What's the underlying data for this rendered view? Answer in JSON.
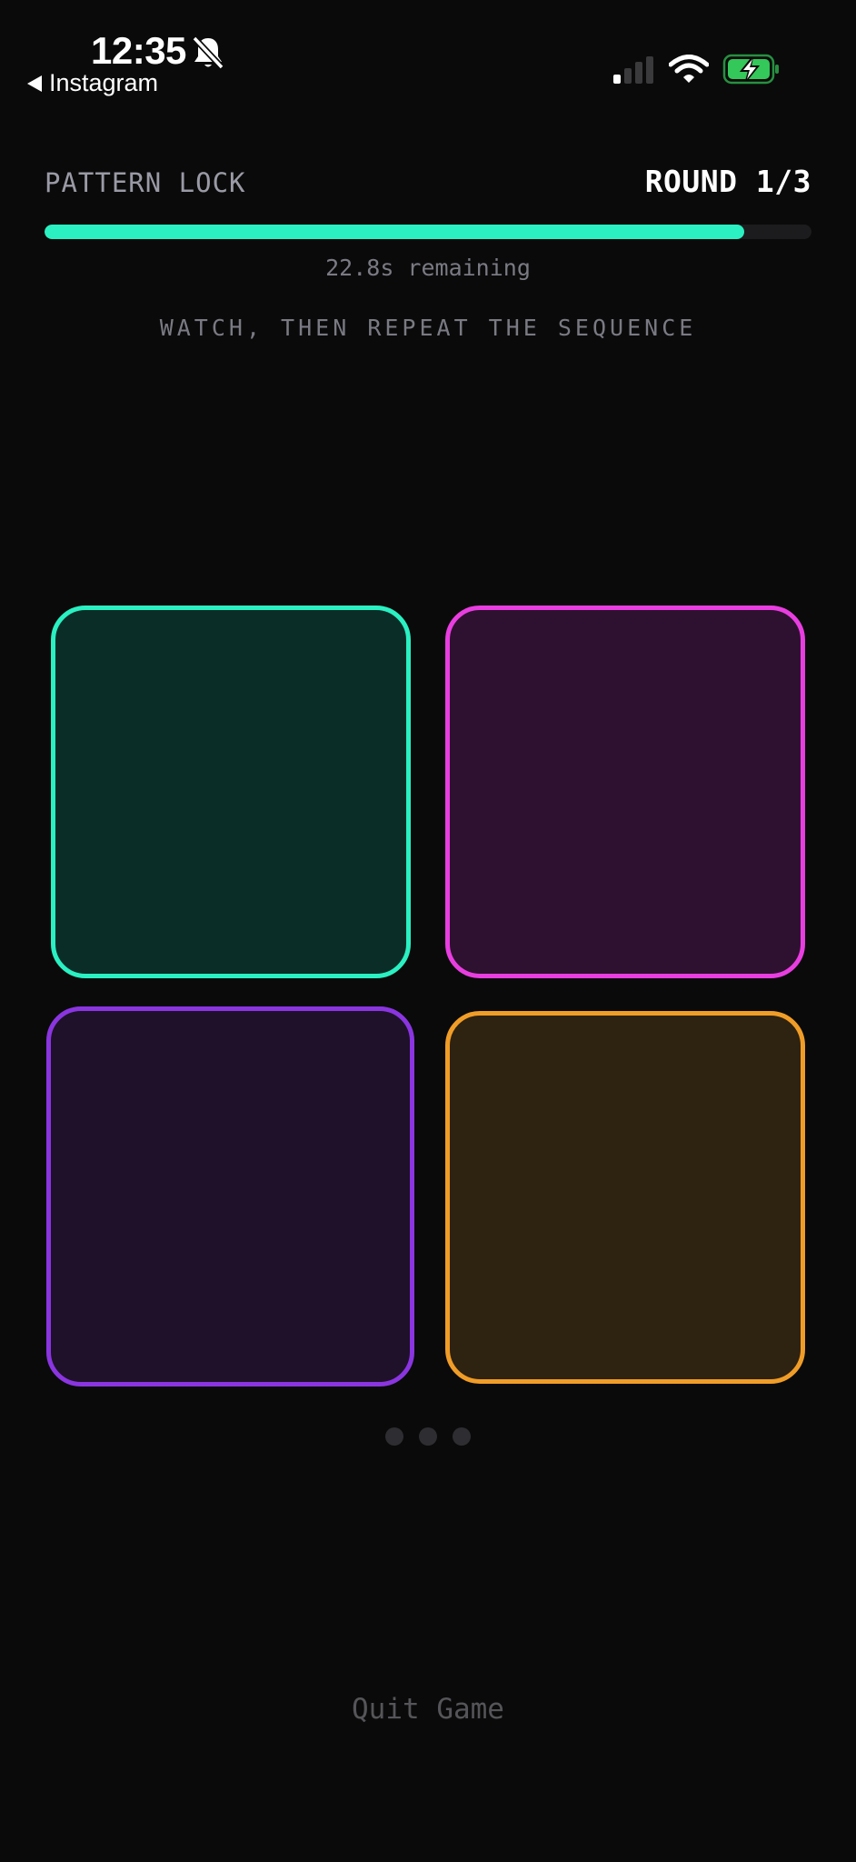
{
  "status_bar": {
    "time": "12:35",
    "back_label": "Instagram",
    "icons": [
      "bell-slash-icon",
      "cellular-signal-icon",
      "wifi-icon",
      "battery-charging-icon"
    ]
  },
  "header": {
    "title": "PATTERN LOCK",
    "round": "ROUND 1/3"
  },
  "progress": {
    "fraction": 0.912,
    "color": "#2af0c2",
    "remaining_text": "22.8s remaining"
  },
  "instruction": "WATCH, THEN REPEAT THE SEQUENCE",
  "pads": [
    {
      "id": "teal",
      "border": "#2af0c2",
      "fill": "#0a2d27"
    },
    {
      "id": "pink",
      "border": "#e83ee0",
      "fill": "#2e1130"
    },
    {
      "id": "purple",
      "border": "#8a35e0",
      "fill": "#1f1129"
    },
    {
      "id": "orange",
      "border": "#f09d28",
      "fill": "#2e2210"
    }
  ],
  "sequence_dots": {
    "count": 3,
    "filled": 0
  },
  "quit_label": "Quit Game"
}
